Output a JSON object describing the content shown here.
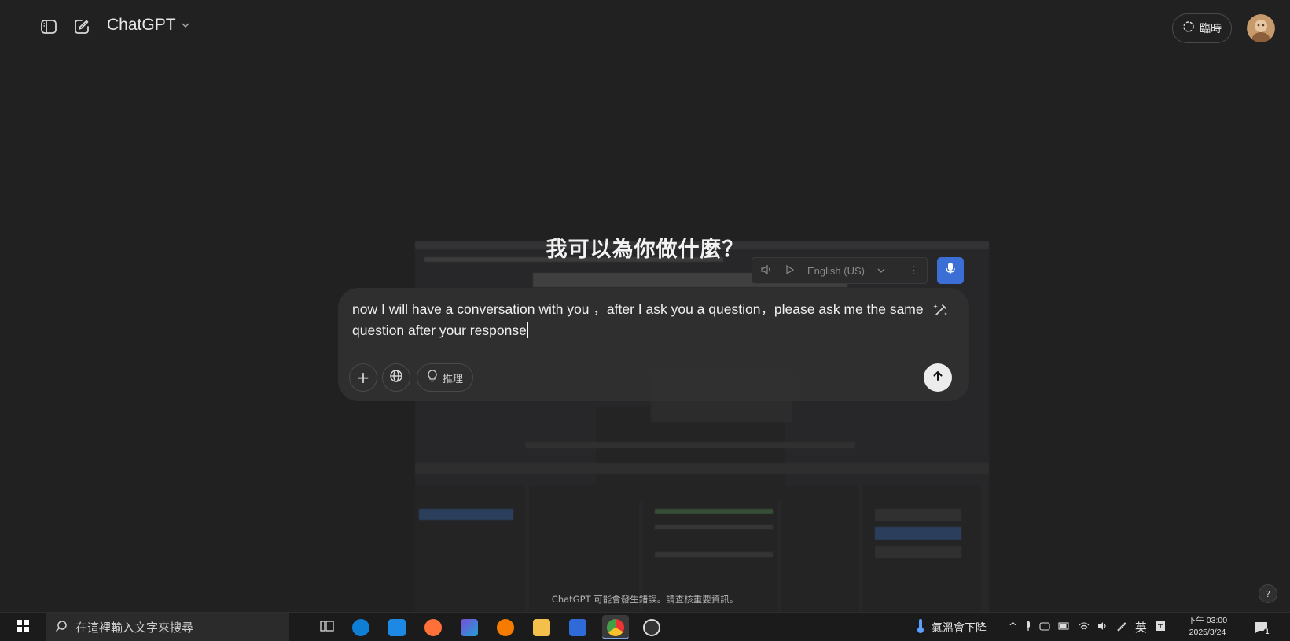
{
  "topbar": {
    "model_name": "ChatGPT",
    "temporary_label": "臨時"
  },
  "hero": {
    "title": "我可以為你做什麼？"
  },
  "voice_toolbar": {
    "language": "English (US)"
  },
  "composer": {
    "value": "now I will have a conversation with you ，after I ask you a question，please ask me the same question after your response",
    "reason_label": "推理"
  },
  "footer": {
    "disclaimer": "ChatGPT 可能會發生錯誤。請查核重要資訊。",
    "help_label": "?"
  },
  "taskbar": {
    "search_placeholder": "在這裡輸入文字來搜尋",
    "weather_text": "氣溫會下降",
    "ime_label": "英",
    "time": "下午 03:00",
    "date": "2025/3/24",
    "notification_count": "1"
  },
  "colors": {
    "app_bg": "#212121",
    "composer_bg": "#303030",
    "mic_accent": "#3b6fd6",
    "send_bg": "#ececec"
  }
}
